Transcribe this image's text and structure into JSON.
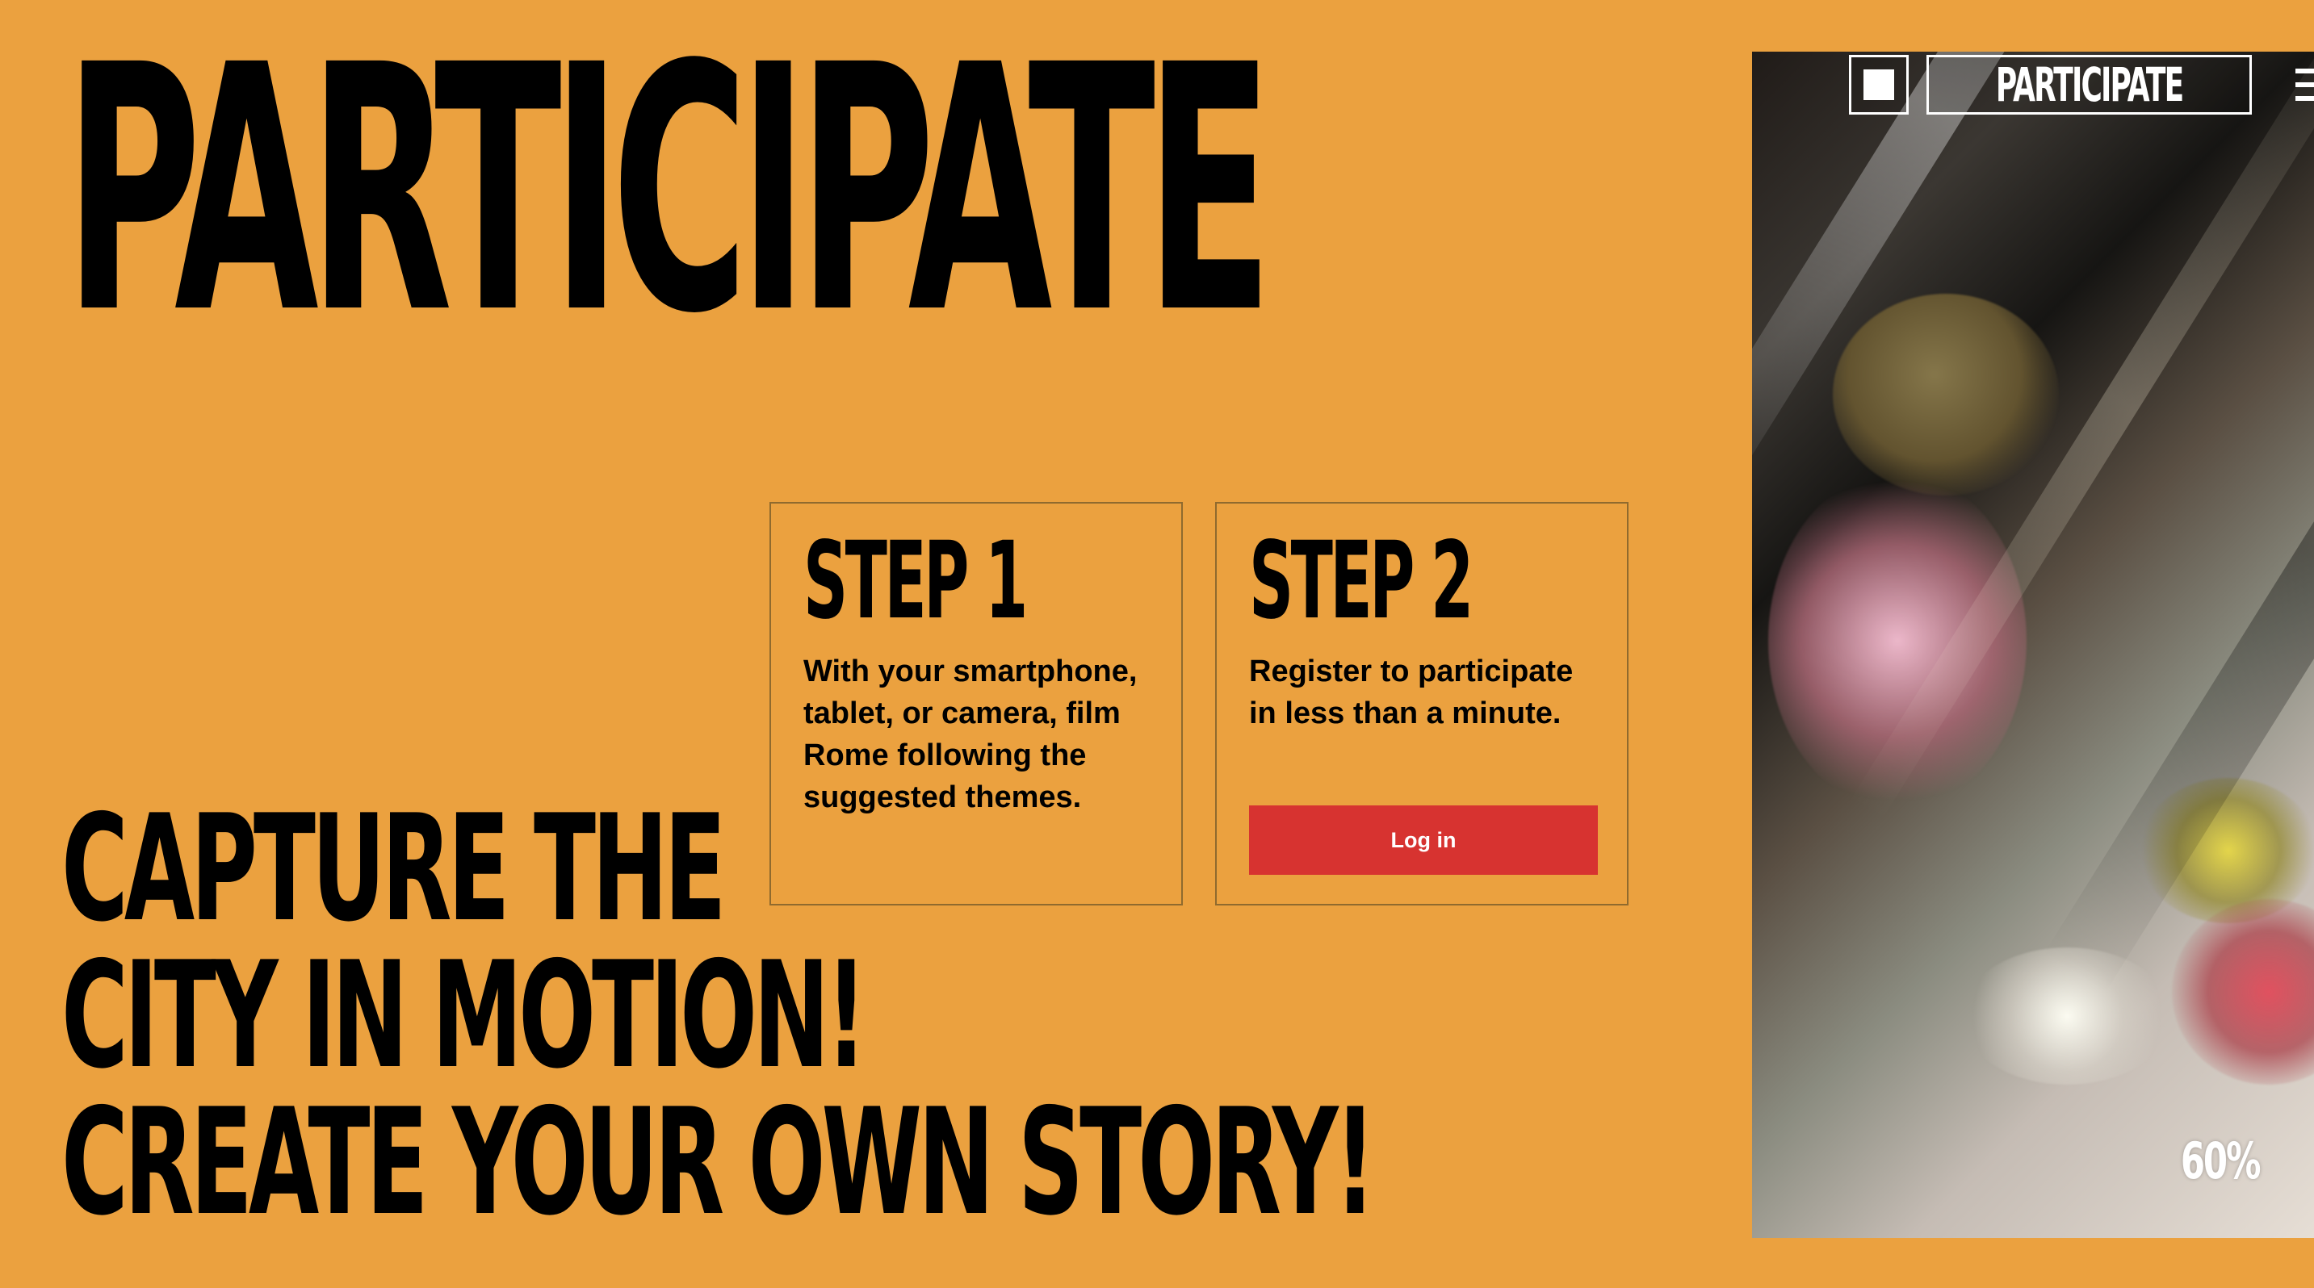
{
  "hero": {
    "title": "PARTICIPATE",
    "tagline": [
      "CAPTURE THE",
      "CITY IN MOTION!",
      "CREATE YOUR OWN STORY!"
    ]
  },
  "steps": [
    {
      "title": "STEP 1",
      "text": "With your smartphone, tablet, or camera, film Rome following the suggested themes."
    },
    {
      "title": "STEP 2",
      "text": "Register to participate in less than a minute.",
      "button_label": "Log in"
    }
  ],
  "media": {
    "nav_button_label": "PARTICIPATE",
    "progress_label": "60%",
    "menu_icon": "hamburger-menu-icon",
    "square_icon": "square-stop-icon"
  },
  "colors": {
    "background": "#EBA13F",
    "accent_button": "#D73330",
    "text": "#000000",
    "overlay_ui": "#FFFFFF"
  }
}
